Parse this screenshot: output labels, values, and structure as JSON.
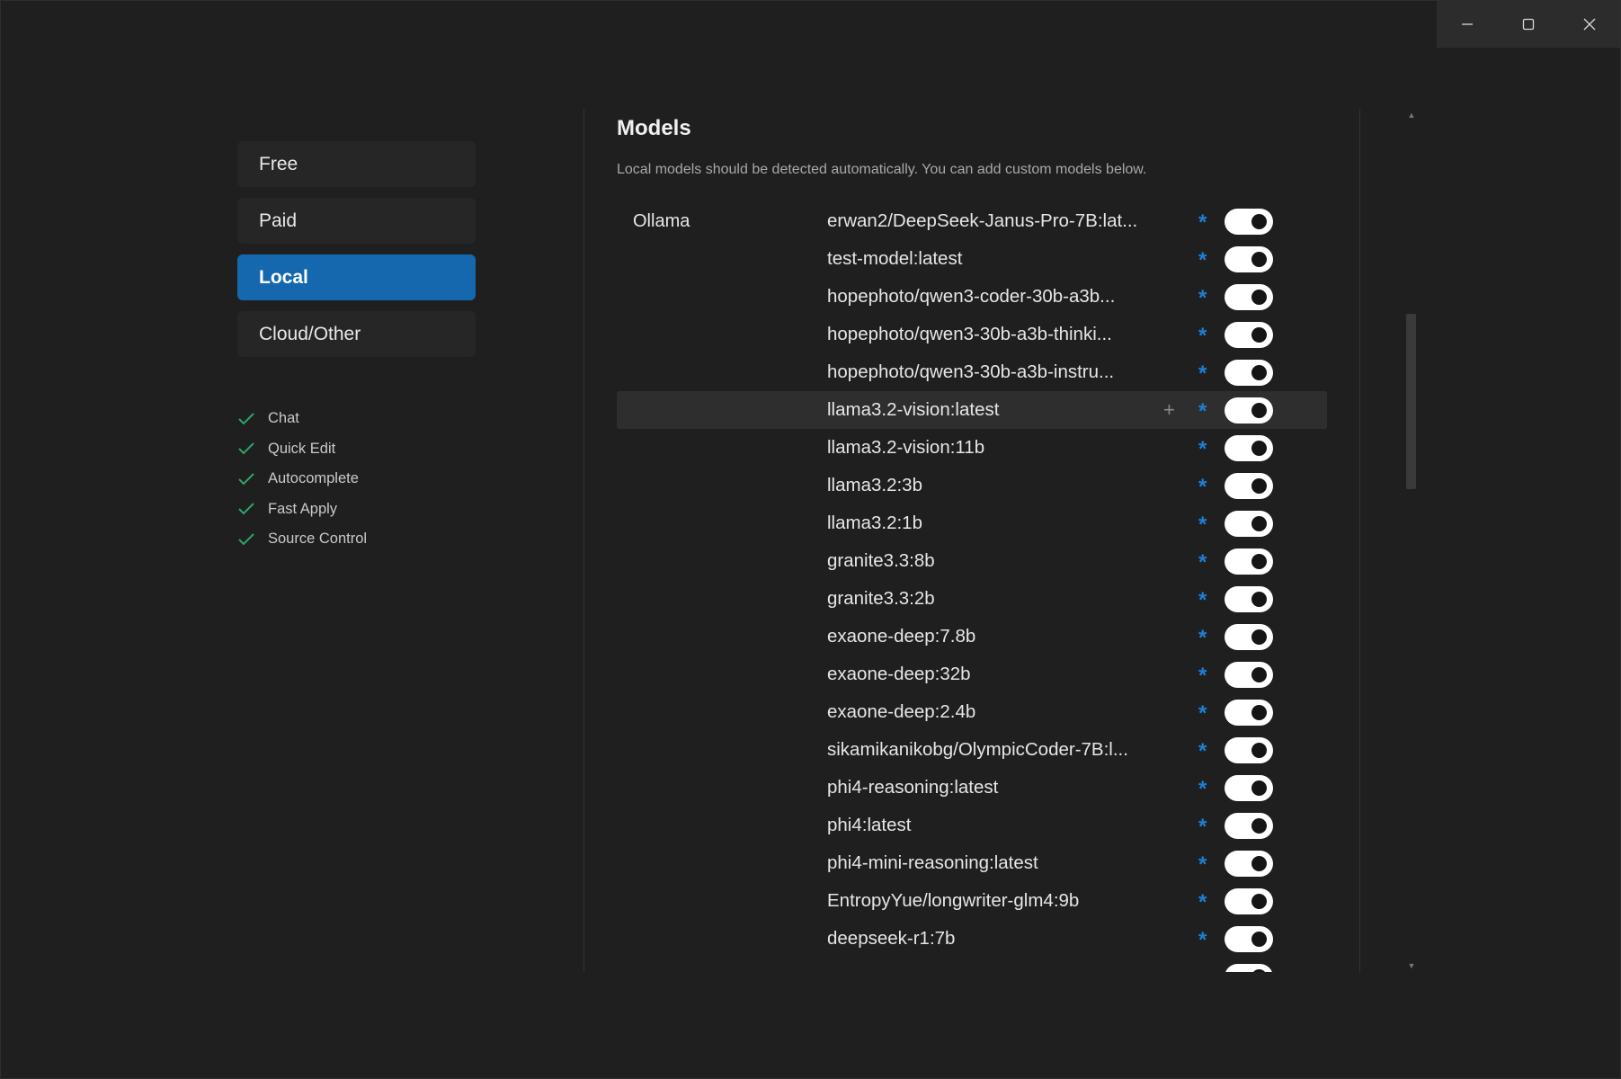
{
  "window_controls": {
    "minimize_icon": "minimize-icon",
    "maximize_icon": "maximize-icon",
    "close_icon": "close-icon"
  },
  "sidebar": {
    "categories": [
      {
        "label": "Free",
        "active": false
      },
      {
        "label": "Paid",
        "active": false
      },
      {
        "label": "Local",
        "active": true
      },
      {
        "label": "Cloud/Other",
        "active": false
      }
    ],
    "features": [
      {
        "label": "Chat",
        "icon": "check-icon"
      },
      {
        "label": "Quick Edit",
        "icon": "check-icon"
      },
      {
        "label": "Autocomplete",
        "icon": "check-icon"
      },
      {
        "label": "Fast Apply",
        "icon": "check-icon"
      },
      {
        "label": "Source Control",
        "icon": "check-icon"
      }
    ]
  },
  "main": {
    "title": "Models",
    "subtitle": "Local models should be detected automatically. You can add custom models below.",
    "provider": "Ollama",
    "models": [
      {
        "name": "erwan2/DeepSeek-Janus-Pro-7B:lat...",
        "enabled": true
      },
      {
        "name": "test-model:latest",
        "enabled": true
      },
      {
        "name": "hopephoto/qwen3-coder-30b-a3b...",
        "enabled": true
      },
      {
        "name": "hopephoto/qwen3-30b-a3b-thinki...",
        "enabled": true
      },
      {
        "name": "hopephoto/qwen3-30b-a3b-instru...",
        "enabled": true
      },
      {
        "name": "llama3.2-vision:latest",
        "enabled": true,
        "hovered": true
      },
      {
        "name": "llama3.2-vision:11b",
        "enabled": true
      },
      {
        "name": "llama3.2:3b",
        "enabled": true
      },
      {
        "name": "llama3.2:1b",
        "enabled": true
      },
      {
        "name": "granite3.3:8b",
        "enabled": true
      },
      {
        "name": "granite3.3:2b",
        "enabled": true
      },
      {
        "name": "exaone-deep:7.8b",
        "enabled": true
      },
      {
        "name": "exaone-deep:32b",
        "enabled": true
      },
      {
        "name": "exaone-deep:2.4b",
        "enabled": true
      },
      {
        "name": "sikamikanikobg/OlympicCoder-7B:l...",
        "enabled": true
      },
      {
        "name": "phi4-reasoning:latest",
        "enabled": true
      },
      {
        "name": "phi4:latest",
        "enabled": true
      },
      {
        "name": "phi4-mini-reasoning:latest",
        "enabled": true
      },
      {
        "name": "EntropyYue/longwriter-glm4:9b",
        "enabled": true
      },
      {
        "name": "deepseek-r1:7b",
        "enabled": true
      },
      {
        "name": "",
        "enabled": true
      }
    ],
    "star_symbol": "*",
    "plus_symbol": "+"
  },
  "colors": {
    "accent": "#1568ad",
    "star": "#1e7fd6",
    "check": "#2ea36b",
    "background": "#1f1f1f"
  }
}
